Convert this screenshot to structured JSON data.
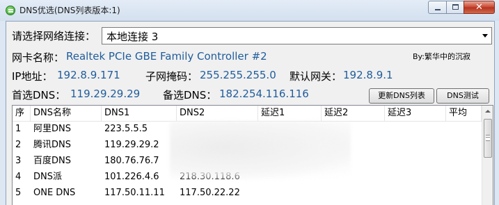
{
  "window": {
    "title": "DNS优选(DNS列表版本:1)",
    "close_glyph": "✕"
  },
  "connection": {
    "label": "请选择网络连接：",
    "selected": "本地连接 3"
  },
  "adapter": {
    "label": "网卡名称：",
    "value": "Realtek PCIe GBE Family Controller #2"
  },
  "author": "By:繁华中的沉寂",
  "network": {
    "ip_label": "IP地址：",
    "ip_value": "192.8.9.171",
    "mask_label": "子网掩码：",
    "mask_value": "255.255.255.0",
    "gateway_label": "默认网关：",
    "gateway_value": "192.8.9.1"
  },
  "dns": {
    "primary_label": "首选DNS：",
    "primary_value": "119.29.29.29",
    "secondary_label": "备选DNS：",
    "secondary_value": "182.254.116.116"
  },
  "buttons": {
    "update": "更新DNS列表",
    "test": "DNS测试"
  },
  "table": {
    "headers": [
      "序",
      "DNS名称",
      "DNS1",
      "DNS2",
      "延迟1",
      "延迟2",
      "延迟3",
      "平均"
    ],
    "rows": [
      [
        "1",
        "阿里DNS",
        "223.5.5.5",
        "",
        "",
        "",
        "",
        ""
      ],
      [
        "2",
        "腾讯DNS",
        "119.29.29.2",
        "",
        "",
        "",
        "",
        ""
      ],
      [
        "3",
        "百度DNS",
        "180.76.76.7",
        "",
        "",
        "",
        "",
        ""
      ],
      [
        "4",
        "DNS派",
        "101.226.4.6",
        "218.30.118.6",
        "",
        "",
        "",
        ""
      ],
      [
        "5",
        "ONE DNS",
        "117.50.11.11",
        "117.50.22.22",
        "",
        "",
        "",
        ""
      ]
    ]
  },
  "icons": [
    "app-icon",
    "minimize-icon",
    "maximize-icon",
    "close-icon",
    "dropdown-arrow-icon",
    "scroll-up-icon"
  ],
  "colors": {
    "value_text": "#1f5c9c",
    "title_bar": "#dce7f3",
    "close_button": "#c8452f"
  }
}
